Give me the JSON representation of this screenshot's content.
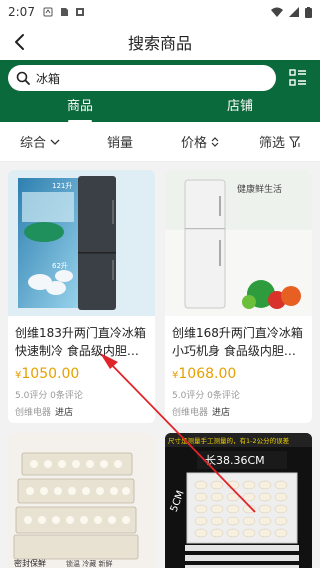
{
  "status_bar": {
    "time": "2:07"
  },
  "header": {
    "title": "搜索商品"
  },
  "search": {
    "value": "冰箱"
  },
  "tabs": [
    {
      "label": "商品",
      "active": true
    },
    {
      "label": "店铺",
      "active": false
    }
  ],
  "sort": {
    "comprehensive": "综合",
    "sales": "销量",
    "price": "价格",
    "filter": "筛选"
  },
  "products": [
    {
      "title": "创维183升两门直冷冰箱快速制冷 食品级内胆 高…",
      "price": "1050.00",
      "reviews": "5.0评分 0条评论",
      "store": "创维电器",
      "enter": "进店",
      "image_labels": [
        "121升",
        "62升"
      ]
    },
    {
      "title": "创维168升两门直冷冰箱小巧机身 食品级内胆材…",
      "price": "1068.00",
      "reviews": "5.0评分 0条评论",
      "store": "创维电器",
      "enter": "进店",
      "image_labels": [
        "健康鲜生活"
      ]
    },
    {
      "image_labels": [
        "密封保鲜",
        "锁温 冷藏 新鲜"
      ]
    },
    {
      "image_labels": [
        "尺寸是测量手工测量的，有1-2公分的误差",
        "长38.36CM",
        "5CM"
      ]
    }
  ],
  "colors": {
    "brand_green": "#0b6a3b",
    "price": "#e6a000",
    "arrow": "#e0242a"
  }
}
